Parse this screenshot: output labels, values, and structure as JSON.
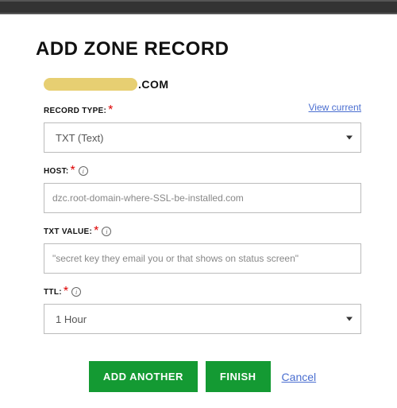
{
  "title": "ADD ZONE RECORD",
  "domain_suffix": ".COM",
  "view_current": "View current",
  "fields": {
    "record_type": {
      "label": "RECORD TYPE:",
      "value": "TXT (Text)"
    },
    "host": {
      "label": "HOST:",
      "value": "dzc.root-domain-where-SSL-be-installed.com"
    },
    "txt_value": {
      "label": "TXT VALUE:",
      "value": "\"secret key they email you or that shows on status screen\""
    },
    "ttl": {
      "label": "TTL:",
      "value": "1 Hour"
    }
  },
  "buttons": {
    "add_another": "ADD ANOTHER",
    "finish": "FINISH",
    "cancel": "Cancel"
  }
}
